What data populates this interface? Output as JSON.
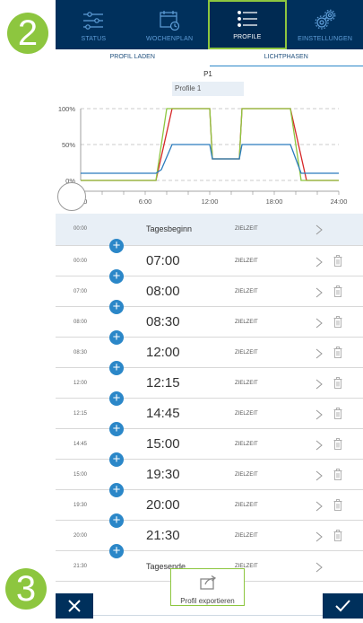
{
  "badges": {
    "step2": "2",
    "step3": "3"
  },
  "nav": {
    "items": [
      {
        "label": "STATUS",
        "icon": "sliders-icon"
      },
      {
        "label": "WOCHENPLAN",
        "icon": "calendar-icon"
      },
      {
        "label": "PROFILE",
        "icon": "list-icon",
        "active": true
      },
      {
        "label": "EINSTELLUNGEN",
        "icon": "gears-icon"
      }
    ]
  },
  "subtabs": {
    "load": "PROFIL LADEN",
    "lightphases": "LICHTPHASEN"
  },
  "profile": {
    "code": "P1",
    "name": "Profile 1"
  },
  "chart_data": {
    "type": "line",
    "x_ticks": [
      "0:00",
      "6:00",
      "12:00",
      "18:00",
      "24:00"
    ],
    "y_ticks": [
      "0%",
      "50%",
      "100%"
    ],
    "xlim": [
      0,
      24
    ],
    "ylim": [
      0,
      100
    ],
    "grid": "dashed at 50% and 100%",
    "series": [
      {
        "color": "#d62728",
        "x": [
          0,
          7,
          8.5,
          12,
          12.25,
          14.75,
          15,
          19.5,
          21,
          24
        ],
        "y": [
          0,
          0,
          100,
          100,
          30,
          30,
          100,
          100,
          0,
          0
        ]
      },
      {
        "color": "#8dc63f",
        "x": [
          0,
          7,
          8,
          12,
          12.25,
          14.75,
          15,
          19.5,
          20.5,
          24
        ],
        "y": [
          0,
          0,
          100,
          100,
          30,
          30,
          100,
          100,
          0,
          0
        ]
      },
      {
        "color": "#2b7bbd",
        "x": [
          0,
          7,
          7.5,
          8.5,
          12,
          12.25,
          14.75,
          15,
          19.5,
          20.5,
          24
        ],
        "y": [
          10,
          10,
          15,
          50,
          50,
          30,
          30,
          50,
          50,
          10,
          10
        ]
      }
    ]
  },
  "rows": [
    {
      "start": "00:00",
      "time": "Tagesbeginn",
      "mode": "ZIELZEIT",
      "type": "label",
      "deletable": false
    },
    {
      "start": "00:00",
      "time": "07:00",
      "mode": "ZIELZEIT",
      "type": "time",
      "deletable": true
    },
    {
      "start": "07:00",
      "time": "08:00",
      "mode": "ZIELZEIT",
      "type": "time",
      "deletable": true
    },
    {
      "start": "08:00",
      "time": "08:30",
      "mode": "ZIELZEIT",
      "type": "time",
      "deletable": true
    },
    {
      "start": "08:30",
      "time": "12:00",
      "mode": "ZIELZEIT",
      "type": "time",
      "deletable": true
    },
    {
      "start": "12:00",
      "time": "12:15",
      "mode": "ZIELZEIT",
      "type": "time",
      "deletable": true
    },
    {
      "start": "12:15",
      "time": "14:45",
      "mode": "ZIELZEIT",
      "type": "time",
      "deletable": true
    },
    {
      "start": "14:45",
      "time": "15:00",
      "mode": "ZIELZEIT",
      "type": "time",
      "deletable": true
    },
    {
      "start": "15:00",
      "time": "19:30",
      "mode": "ZIELZEIT",
      "type": "time",
      "deletable": true
    },
    {
      "start": "19:30",
      "time": "20:00",
      "mode": "ZIELZEIT",
      "type": "time",
      "deletable": true
    },
    {
      "start": "20:00",
      "time": "21:30",
      "mode": "ZIELZEIT",
      "type": "time",
      "deletable": true
    },
    {
      "start": "21:30",
      "time": "Tagesende",
      "mode": "ZIELZEIT",
      "type": "label",
      "deletable": false
    }
  ],
  "export": {
    "label": "Profil exportieren",
    "icon": "export-icon"
  },
  "footer": {
    "cancel_icon": "close-icon",
    "confirm_icon": "checkmark-icon"
  },
  "colors": {
    "nav_bg": "#00305c",
    "accent_green": "#8dc63f",
    "accent_blue": "#2b87c8"
  }
}
